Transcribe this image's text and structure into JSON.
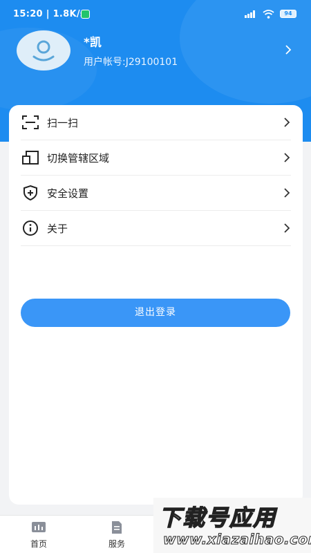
{
  "status_bar": {
    "time_speed": "15:20 | 1.8K/s",
    "battery": "94",
    "shield_icon": "shield-check-icon",
    "signal_icon": "signal-icon",
    "wifi_icon": "wifi-icon"
  },
  "profile": {
    "name": "*凯",
    "account": "用户帐号:J29100101",
    "avatar_icon": "user-avatar-icon"
  },
  "menu": {
    "items": [
      {
        "label": "扫一扫",
        "icon": "scan-icon"
      },
      {
        "label": "切换管辖区域",
        "icon": "switch-area-icon"
      },
      {
        "label": "安全设置",
        "icon": "shield-plus-icon"
      },
      {
        "label": "关于",
        "icon": "info-icon"
      }
    ]
  },
  "logout_label": "退出登录",
  "tabbar": {
    "tabs": [
      {
        "label": "首页",
        "icon": "home-chart-icon"
      },
      {
        "label": "服务",
        "icon": "document-icon"
      }
    ]
  },
  "watermark": {
    "top_text": "下载号应用",
    "bottom_text": "www.xiazaihao.com"
  },
  "colors": {
    "header": "#1d8cf0",
    "button": "#3a96f7",
    "page_bg": "#f2f3f5"
  }
}
